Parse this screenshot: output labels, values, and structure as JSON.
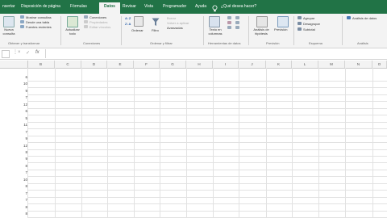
{
  "tabs": [
    {
      "label": "nsertar",
      "active": false
    },
    {
      "label": "Disposición de página",
      "active": false
    },
    {
      "label": "Fórmulas",
      "active": false
    },
    {
      "label": "Datos",
      "active": true
    },
    {
      "label": "Revisar",
      "active": false
    },
    {
      "label": "Vista",
      "active": false
    },
    {
      "label": "Programador",
      "active": false
    },
    {
      "label": "Ayuda",
      "active": false
    },
    {
      "label": "¿Qué desea hacer?",
      "active": false
    }
  ],
  "ribbon": {
    "get_data": {
      "new_query": "Nueva consulta",
      "show_queries": "Mostrar consultas",
      "from_table": "Desde una tabla",
      "recent_sources": "Fuentes recientes",
      "group": "Obtener y transformar"
    },
    "connections": {
      "refresh_all": "Actualizar todo",
      "connections": "Conexiones",
      "properties": "Propiedades",
      "edit_links": "Editar vínculos",
      "group": "Conexiones"
    },
    "sort_filter": {
      "sort": "Ordenar",
      "filter": "Filtro",
      "clear": "Borrar",
      "reapply": "Volver a aplicar",
      "advanced": "Avanzadas",
      "group": "Ordenar y filtrar"
    },
    "data_tools": {
      "text_to_columns": "Texto en columnas",
      "group": "Herramientas de datos"
    },
    "forecast": {
      "what_if": "Análisis de hipótesis",
      "forecast_sheet": "Previsión",
      "group": "Previsión"
    },
    "outline": {
      "group_btn": "Agrupar",
      "ungroup": "Desagrupar",
      "subtotal": "Subtotal",
      "group": "Esquema"
    },
    "analysis": {
      "data_analysis": "Análisis de datos",
      "group": "Análisis"
    }
  },
  "formula_bar": {
    "fx": "fx",
    "cancel": "×",
    "enter": "✓",
    "value": ""
  },
  "columns": [
    "B",
    "C",
    "D",
    "E",
    "F",
    "G",
    "H",
    "I",
    "J",
    "K",
    "L",
    "M",
    "N",
    "O"
  ],
  "rows": [
    "6",
    "10",
    "9",
    "7",
    "12",
    "6",
    "5",
    "11",
    "7",
    "9",
    "12",
    "8",
    "9",
    "8",
    "7",
    "10",
    "8",
    "7",
    "7",
    "8",
    "8"
  ],
  "colors": {
    "brand": "#217346",
    "ribbon_bg": "#f3f3f3",
    "grid_line": "#e2e2e2"
  }
}
